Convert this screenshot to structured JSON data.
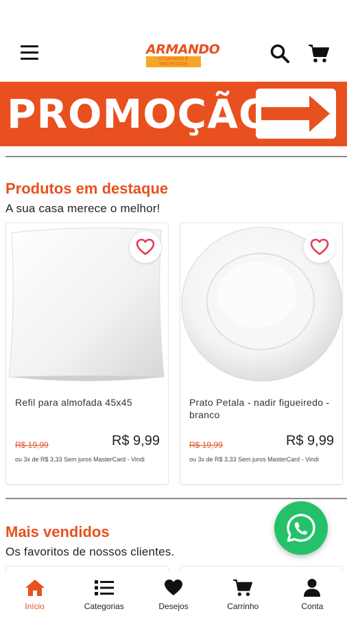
{
  "header": {
    "menu_icon": "hamburger-menu-icon",
    "logo": {
      "main": "ARMANDO",
      "sub": "UTILIDADES E IMPORTADOS"
    },
    "search_icon": "search-icon",
    "cart_icon": "cart-icon"
  },
  "promo_banner": {
    "text": "PROMOÇÃO",
    "icon": "arrow-right-icon",
    "color": "#e8501f"
  },
  "featured": {
    "title": "Produtos em destaque",
    "subtitle": "A sua casa merece o melhor!",
    "products": [
      {
        "name": "Refil para almofada 45x45",
        "old_price": "R$ 19,99",
        "price": "R$ 9,99",
        "installments": "ou 3x de R$ 3,33 Sem juros MasterCard - Vindi",
        "image": "pillow-image"
      },
      {
        "name": "Prato Petala - nadir figueiredo - branco",
        "old_price": "R$ 19,99",
        "price": "R$ 9,99",
        "installments": "ou 3x de R$ 3,33 Sem juros MasterCard - Vindi",
        "image": "plate-image"
      }
    ]
  },
  "best_sellers": {
    "title": "Mais vendidos",
    "subtitle": "Os favoritos de nossos clientes."
  },
  "whatsapp_icon": "whatsapp-icon",
  "bottom_nav": [
    {
      "label": "Início",
      "icon": "home-icon",
      "active": true
    },
    {
      "label": "Categorias",
      "icon": "list-icon",
      "active": false
    },
    {
      "label": "Desejos",
      "icon": "heart-icon",
      "active": false
    },
    {
      "label": "Carrinho",
      "icon": "cart-icon",
      "active": false
    },
    {
      "label": "Conta",
      "icon": "user-icon",
      "active": false
    }
  ],
  "colors": {
    "accent": "#e8501f",
    "whatsapp": "#25c16a",
    "text": "#222222"
  }
}
